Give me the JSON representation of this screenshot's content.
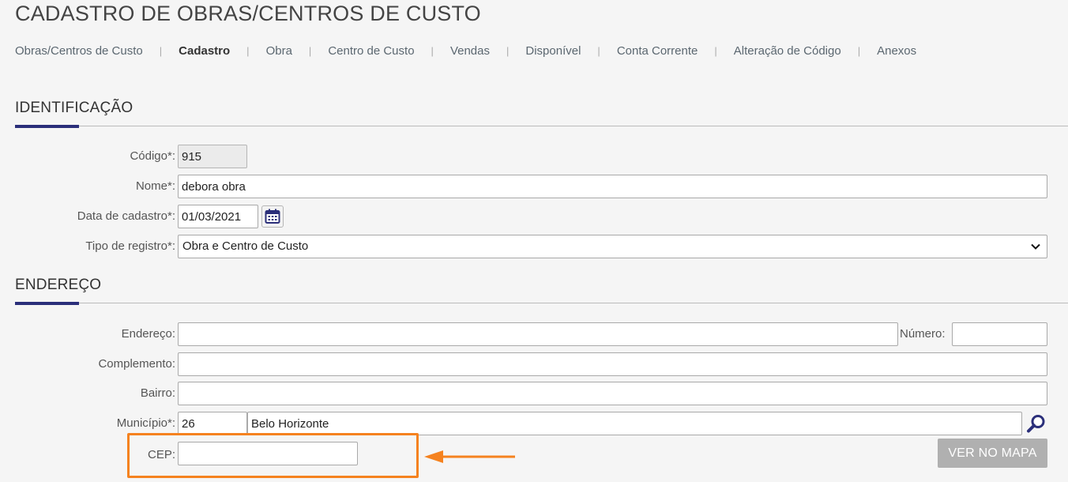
{
  "page_title": "CADASTRO DE OBRAS/CENTROS DE CUSTO",
  "tabs": [
    {
      "label": "Obras/Centros de Custo"
    },
    {
      "label": "Cadastro"
    },
    {
      "label": "Obra"
    },
    {
      "label": "Centro de Custo"
    },
    {
      "label": "Vendas"
    },
    {
      "label": "Disponível"
    },
    {
      "label": "Conta Corrente"
    },
    {
      "label": "Alteração de Código"
    },
    {
      "label": "Anexos"
    }
  ],
  "active_tab": "Cadastro",
  "tab_separator": "|",
  "identificacao": {
    "title": "IDENTIFICAÇÃO",
    "codigo_label": "Código*:",
    "codigo_value": "915",
    "nome_label": "Nome*:",
    "nome_value": "debora obra",
    "data_label": "Data de cadastro*:",
    "data_value": "01/03/2021",
    "tipo_label": "Tipo de registro*:",
    "tipo_value": "Obra e Centro de Custo"
  },
  "endereco": {
    "title": "ENDEREÇO",
    "endereco_label": "Endereço:",
    "endereco_value": "",
    "numero_label": "Número:",
    "numero_value": "",
    "complemento_label": "Complemento:",
    "complemento_value": "",
    "bairro_label": "Bairro:",
    "bairro_value": "",
    "municipio_label": "Município*:",
    "municipio_code": "26",
    "municipio_name": "Belo Horizonte",
    "cep_label": "CEP:",
    "cep_value": "",
    "map_button": "VER NO MAPA"
  },
  "colors": {
    "accent": "#2b2f7a",
    "highlight": "#f5821f",
    "map_button_bg": "#b0b0b0"
  },
  "icons": {
    "calendar": "calendar-icon",
    "search": "search-icon",
    "chevron": "chevron-down-icon",
    "arrow": "arrow-left-icon"
  }
}
